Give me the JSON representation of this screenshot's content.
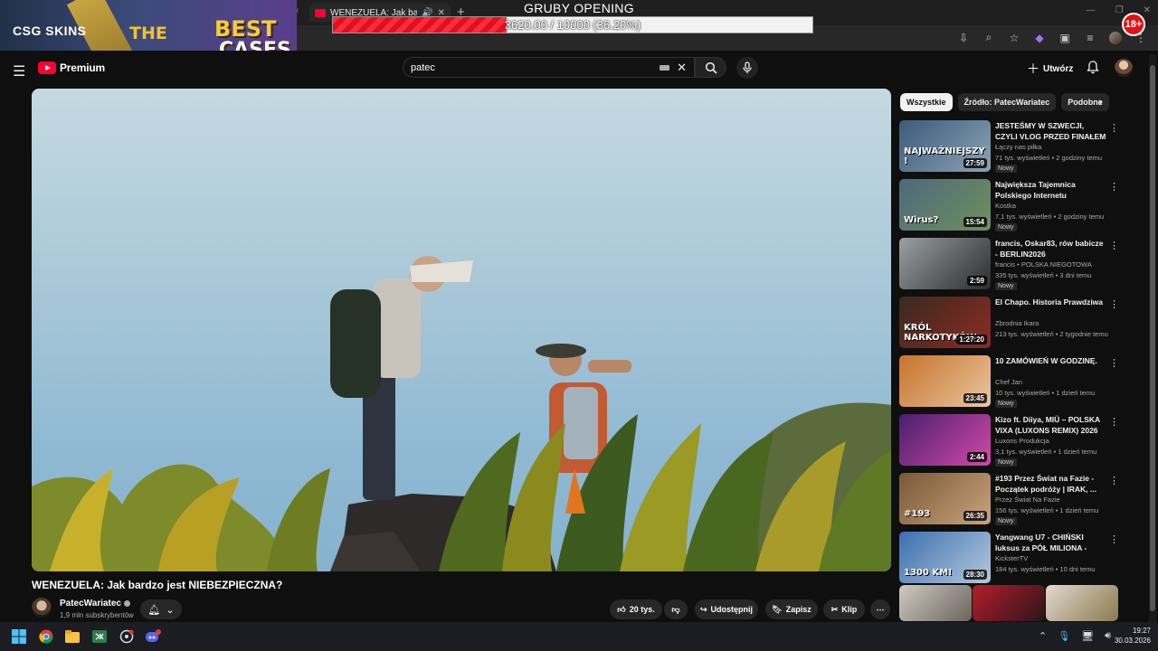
{
  "browser": {
    "tab_title": "WENEZUELA: Jak bardzo je",
    "tab_audio_icon": "speaker-icon",
    "tab_close": "✕",
    "new_tab": "+"
  },
  "stream_overlay": {
    "logo_text": "CSG SKINS",
    "banner_word_1": "THE",
    "banner_word_2": "BEST",
    "banner_word_3": "CASES",
    "goal_title": "GRUBY OPENING",
    "goal_text": "3620.00 / 10000 (36.20%)",
    "goal_progress": 0.362,
    "age_badge": "18+"
  },
  "youtube": {
    "logo_word": "Premium",
    "search": {
      "value": "patec"
    },
    "create_label": "Utwórz"
  },
  "video": {
    "title": "WENEZUELA: Jak bardzo jest NIEBEZPIECZNA?",
    "channel": "PatecWariatec",
    "subscribers": "1,9 mln subskrybentów",
    "likes": "20 tys.",
    "share_label": "Udostępnij",
    "save_label": "Zapisz",
    "clip_label": "Klip"
  },
  "chips": [
    "Wszystkie",
    "Źródło: PatecWariatec",
    "Podobne"
  ],
  "recommendations": [
    {
      "title": "JESTEŚMY W SZWECJI, CZYLI VLOG PRZED FINAŁEM | Robot...",
      "channel": "Łączy nas piłka",
      "meta": "71 tys. wyświetleń • 2 godziny temu",
      "badge": "Nowy",
      "duration": "27:59",
      "thumb_caption": "NAJWAŻNIEJSZY !",
      "colors": [
        "#3b5b7a",
        "#8aa3b6"
      ]
    },
    {
      "title": "Największa Tajemnica Polskiego Internetu",
      "channel": "Kostka",
      "meta": "7,1 tys. wyświetleń • 2 godziny temu",
      "badge": "Nowy",
      "duration": "15:54",
      "thumb_caption": "Wirus?",
      "colors": [
        "#4c6a7e",
        "#6f8f5a"
      ]
    },
    {
      "title": "francis, Oskar83, rów babicze - BERLIN2026",
      "channel": "francis • POLSKA NIEGOTOWA",
      "meta": "335 tys. wyświetleń • 3 dni temu",
      "badge": "Nowy",
      "duration": "2:59",
      "thumb_caption": "",
      "colors": [
        "#9aa0a4",
        "#2b2b2b"
      ]
    },
    {
      "title": "El Chapo. Historia Prawdziwa",
      "channel": "Zbrodnia Ikara",
      "meta": "213 tys. wyświetleń • 2 tygodnie temu",
      "badge": "",
      "duration": "1:27:20",
      "thumb_caption": "KRÓL NARKOTYKÓW",
      "colors": [
        "#3a2a1e",
        "#8c2b23"
      ]
    },
    {
      "title": "10 ZAMÓWIEŃ W GODZINĘ.",
      "channel": "Chef Jan",
      "meta": "10 tys. wyświetleń • 1 dzień temu",
      "badge": "Nowy",
      "duration": "23:45",
      "thumb_caption": "",
      "colors": [
        "#c8732b",
        "#e9c6a0"
      ]
    },
    {
      "title": "Kizo ft. Diiya, MIÜ – POLSKA VIXA (LUXONS REMIX) 2026",
      "channel": "Luxons Produkcja",
      "meta": "3,1 tys. wyświetleń • 1 dzień temu",
      "badge": "Nowy",
      "duration": "2:44",
      "thumb_caption": "",
      "colors": [
        "#4a1e6e",
        "#d14aa7"
      ]
    },
    {
      "title": "#193 Przez Świat na Fazie - Początek podróży | IRAK, ...",
      "channel": "Przez Świat Na Fazie",
      "meta": "156 tys. wyświetleń • 1 dzień temu",
      "badge": "Nowy",
      "duration": "26:35",
      "thumb_caption": "#193",
      "colors": [
        "#7a5838",
        "#c9a37a"
      ]
    },
    {
      "title": "Yangwang U7 - CHIŃSKI luksus za PÓŁ MILIONA - Kickster ...",
      "channel": "KicksterTV",
      "meta": "184 tys. wyświetleń • 10 dni temu",
      "badge": "",
      "duration": "28:30",
      "thumb_caption": "1300 KM!",
      "colors": [
        "#3c6fb0",
        "#b4c8dc"
      ]
    }
  ],
  "taskbar": {
    "time": "19:27",
    "date": "30.03.2026"
  }
}
